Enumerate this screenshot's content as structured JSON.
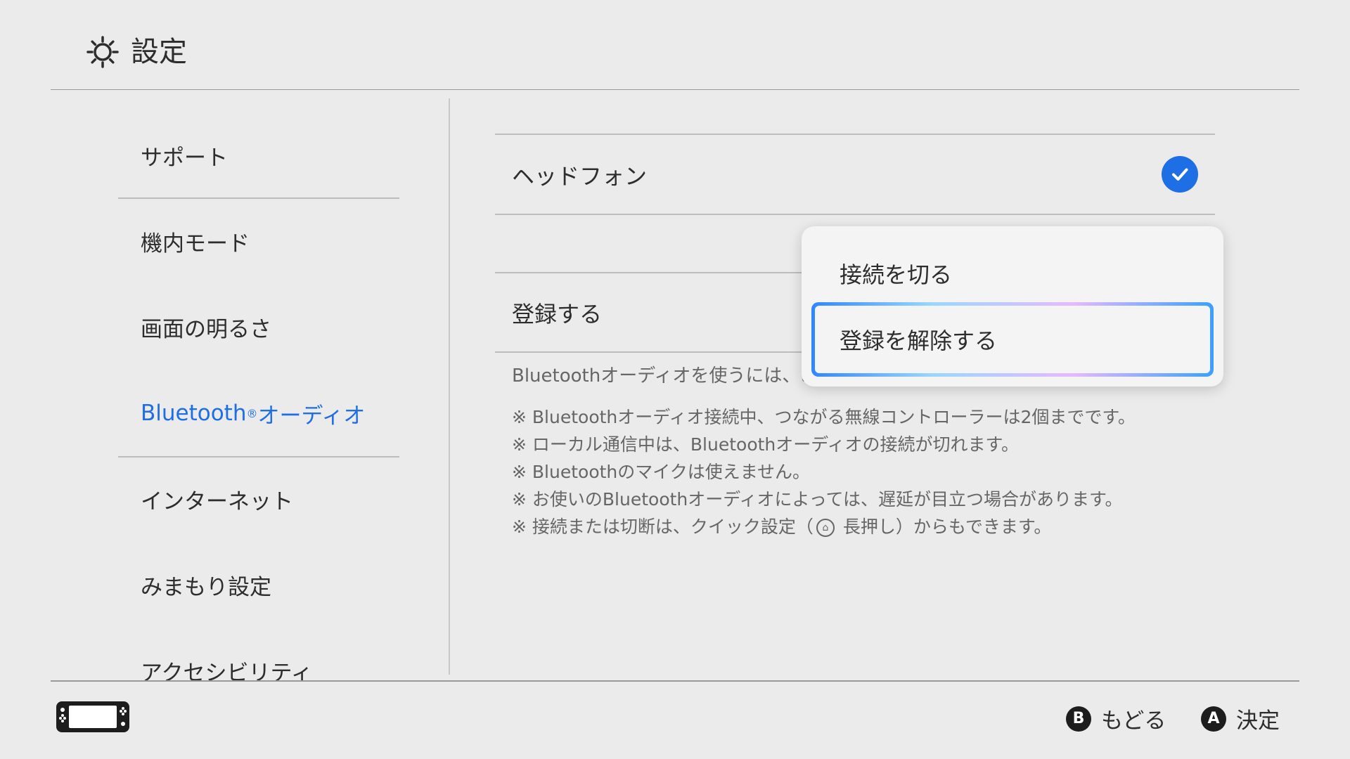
{
  "header": {
    "title": "設定",
    "icon": "gear-icon"
  },
  "sidebar": {
    "items": [
      {
        "label": "サポート"
      },
      {
        "label": "機内モード"
      },
      {
        "label": "画面の明るさ"
      },
      {
        "label": "Bluetooth",
        "reg": "®",
        "suffix": "オーディオ",
        "active": true
      },
      {
        "label": "インターネット"
      },
      {
        "label": "みまもり設定"
      },
      {
        "label": "アクセシビリティ"
      }
    ]
  },
  "main": {
    "device_name": "ヘッドフォン",
    "device_connected": true,
    "register_label": "登録する",
    "description": "Bluetoothオーディオを使うには、あ",
    "notes": [
      "※ Bluetoothオーディオ接続中、つながる無線コントローラーは2個までです。",
      "※ ローカル通信中は、Bluetoothオーディオの接続が切れます。",
      "※ Bluetoothのマイクは使えません。",
      "※ お使いのBluetoothオーディオによっては、遅延が目立つ場合があります。"
    ],
    "note_last_prefix": "※ 接続または切断は、クイック設定（",
    "note_last_suffix": " 長押し）からもできます。"
  },
  "popup": {
    "items": [
      {
        "label": "接続を切る"
      },
      {
        "label": "登録を解除する",
        "selected": true
      }
    ]
  },
  "footer": {
    "back": {
      "glyph": "B",
      "label": "もどる"
    },
    "ok": {
      "glyph": "A",
      "label": "決定"
    }
  },
  "colors": {
    "accent": "#1e6ee6",
    "background": "#ebebeb"
  }
}
